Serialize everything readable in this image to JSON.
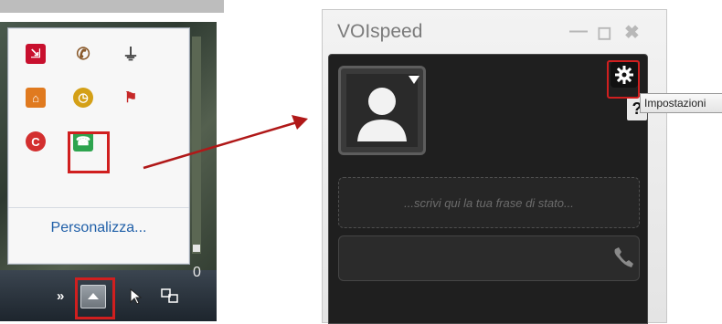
{
  "tray": {
    "more_label": "Personalizza...",
    "icons": [
      {
        "name": "redirect-icon",
        "color": "#c8102e"
      },
      {
        "name": "phone-icon",
        "color": "#8a5a2b"
      },
      {
        "name": "power-plug-icon",
        "color": "#555555"
      },
      {
        "name": "home-security-icon",
        "color": "#e07a1f"
      },
      {
        "name": "clock-shield-icon",
        "color": "#d4a017"
      },
      {
        "name": "flag-error-icon",
        "color": "#c62828"
      },
      {
        "name": "ccleaner-icon",
        "color": "#d32f2f"
      },
      {
        "name": "voispeed-tray-icon",
        "color": "#2ea44f"
      }
    ]
  },
  "taskbar": {
    "chevron": "»",
    "clock_fragment": "0"
  },
  "voispeed": {
    "title": "VOIspeed",
    "minimize": "—",
    "maximize": "◻",
    "close": "✖",
    "status_placeholder": "...scrivi qui la tua frase di stato...",
    "help_label": "?",
    "tooltip": "Impostazioni"
  },
  "colors": {
    "highlight": "#d01f1f",
    "arrow": "#b01818",
    "panel_bg": "#1f1f1f"
  }
}
